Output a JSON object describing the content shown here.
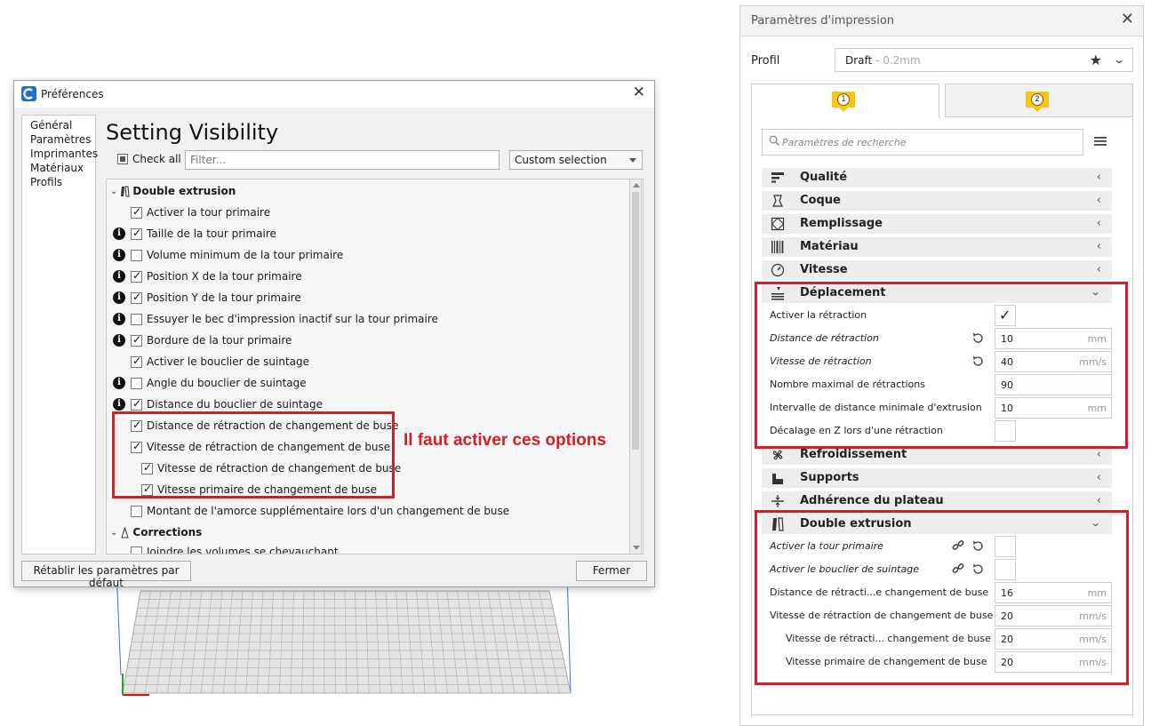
{
  "preferences": {
    "title": "Préférences",
    "nav": [
      "Général",
      "Paramètres",
      "Imprimantes",
      "Matériaux",
      "Profils"
    ],
    "heading": "Setting Visibility",
    "check_all_label": "Check all",
    "filter_placeholder": "Filter...",
    "visibility_preset": "Custom selection",
    "categories": {
      "double_extrusion": "Double extrusion",
      "corrections": "Corrections"
    },
    "settings": [
      {
        "label": "Activer la tour primaire",
        "checked": true,
        "info": false,
        "indent": 0
      },
      {
        "label": "Taille de la tour primaire",
        "checked": true,
        "info": true,
        "indent": 0
      },
      {
        "label": "Volume minimum de la tour primaire",
        "checked": false,
        "info": true,
        "indent": 0
      },
      {
        "label": "Position X de la tour primaire",
        "checked": true,
        "info": true,
        "indent": 0
      },
      {
        "label": "Position Y de la tour primaire",
        "checked": true,
        "info": true,
        "indent": 0
      },
      {
        "label": "Essuyer le bec d'impression inactif sur la tour primaire",
        "checked": false,
        "info": true,
        "indent": 0
      },
      {
        "label": "Bordure de la tour primaire",
        "checked": true,
        "info": true,
        "indent": 0
      },
      {
        "label": "Activer le bouclier de suintage",
        "checked": true,
        "info": false,
        "indent": 0
      },
      {
        "label": "Angle du bouclier de suintage",
        "checked": false,
        "info": true,
        "indent": 0
      },
      {
        "label": "Distance du bouclier de suintage",
        "checked": true,
        "info": true,
        "indent": 0
      },
      {
        "label": "Distance de rétraction de changement de buse",
        "checked": true,
        "info": false,
        "indent": 0
      },
      {
        "label": "Vitesse de rétraction de changement de buse",
        "checked": true,
        "info": false,
        "indent": 0
      },
      {
        "label": "Vitesse de rétraction de changement de buse",
        "checked": true,
        "info": false,
        "indent": 1
      },
      {
        "label": "Vitesse primaire de changement de buse",
        "checked": true,
        "info": false,
        "indent": 1
      },
      {
        "label": "Montant de l'amorce supplémentaire lors d'un changement de buse",
        "checked": false,
        "info": false,
        "indent": 0
      }
    ],
    "partial_row": "Joindre les volumes se chevauchant",
    "annotation": "Il faut activer ces options",
    "reset_button": "Rétablir les paramètres par défaut",
    "close_button": "Fermer"
  },
  "print_settings": {
    "title": "Paramètres d'impression",
    "profile_label": "Profil",
    "profile_name": "Draft",
    "profile_suffix": " - 0.2mm",
    "extruder_tabs": [
      "1",
      "2"
    ],
    "search_placeholder": "Paramètres de recherche",
    "sections": {
      "qualite": "Qualité",
      "coque": "Coque",
      "remplissage": "Remplissage",
      "materiau": "Matériau",
      "vitesse": "Vitesse",
      "deplacement": "Déplacement",
      "refroidissement": "Refroidissement",
      "supports": "Supports",
      "adherence": "Adhérence du plateau",
      "double_extrusion": "Double extrusion"
    },
    "travel": {
      "retraction_enable": "Activer la rétraction",
      "retraction_distance": {
        "label": "Distance de rétraction",
        "value": "10",
        "unit": "mm"
      },
      "retraction_speed": {
        "label": "Vitesse de rétraction",
        "value": "40",
        "unit": "mm/s"
      },
      "max_retractions": {
        "label": "Nombre maximal de rétractions",
        "value": "90"
      },
      "min_extrusion_window": {
        "label": "Intervalle de distance minimale d'extrusion",
        "value": "10",
        "unit": "mm"
      },
      "z_hop": "Décalage en Z lors d'une rétraction"
    },
    "dual": {
      "prime_tower": "Activer la tour primaire",
      "ooze_shield": "Activer le bouclier de suintage",
      "switch_distance": {
        "label": "Distance de rétracti...e changement de buse",
        "value": "16",
        "unit": "mm"
      },
      "switch_speed": {
        "label": "Vitesse de rétraction de changement de buse",
        "value": "20",
        "unit": "mm/s"
      },
      "switch_retract_speed": {
        "label": "Vitesse de rétracti... changement de buse",
        "value": "20",
        "unit": "mm/s"
      },
      "switch_prime_speed": {
        "label": "Vitesse primaire de changement de buse",
        "value": "20",
        "unit": "mm/s"
      }
    }
  }
}
